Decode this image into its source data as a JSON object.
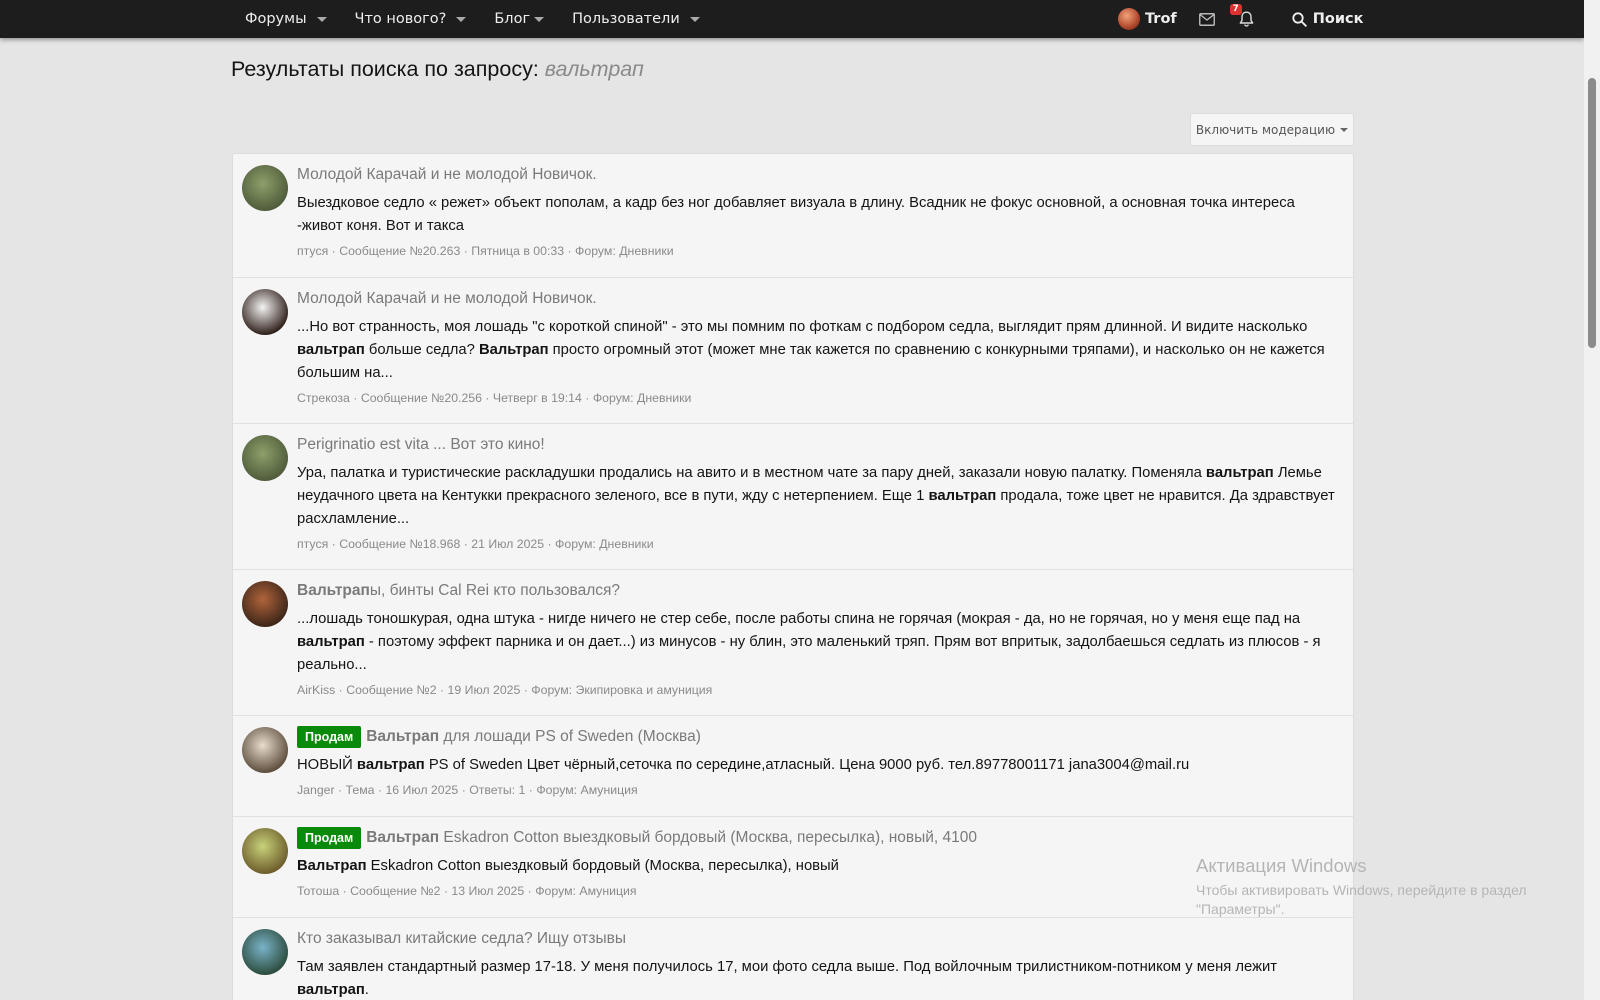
{
  "nav": {
    "items": [
      {
        "label": "Форумы"
      },
      {
        "label": "Что нового?"
      },
      {
        "label": "Блог"
      },
      {
        "label": "Пользователи"
      }
    ],
    "user": "Trof",
    "alerts_count": "7",
    "search_label": "Поиск"
  },
  "page": {
    "title_prefix": "Результаты поиска по запросу:",
    "query": "вальтрап",
    "moderation_button": "Включить модерацию"
  },
  "results": [
    {
      "title_pre": "",
      "title_bold": "",
      "title_rest": "Молодой Карачай и не молодой Новичок.",
      "label": "",
      "snippet": [
        {
          "t": "Выездковое седло « режет» объект пополам, а кадр без ног добавляет визуала в длину. Всадник не фокус основной, а основная точка интереса -живот коня. Вот и такса",
          "b": false
        }
      ],
      "meta": [
        "птуся",
        "Сообщение №20.263",
        "Пятница в 00:33",
        "Форум: Дневники"
      ],
      "avatar_colors": [
        "#8da06a",
        "#4e5a3a"
      ]
    },
    {
      "title_pre": "",
      "title_bold": "",
      "title_rest": "Молодой Карачай и не молодой Новичок.",
      "label": "",
      "snippet": [
        {
          "t": "...Но вот странность, моя лошадь \"с короткой спиной\" - это мы помним по фоткам с подбором седла, выглядит прям длинной. И видите насколько ",
          "b": false
        },
        {
          "t": "вальтрап",
          "b": true
        },
        {
          "t": " больше седла? ",
          "b": false
        },
        {
          "t": "Вальтрап",
          "b": true
        },
        {
          "t": " просто огромный этот (может мне так кажется по сравнению с конкурными тряпами), и насколько он не кажется большим на...",
          "b": false
        }
      ],
      "meta": [
        "Стрекоза",
        "Сообщение №20.256",
        "Четверг в 19:14",
        "Форум: Дневники"
      ],
      "avatar_colors": [
        "#f3f3f3",
        "#2a1a14"
      ]
    },
    {
      "title_pre": "",
      "title_bold": "",
      "title_rest": "Perigrinatio est vita ... Вот это кино!",
      "label": "",
      "snippet": [
        {
          "t": "Ура, палатка и туристические раскладушки продались на авито и в местном чате за пару дней, заказали новую палатку. Поменяла ",
          "b": false
        },
        {
          "t": "вальтрап",
          "b": true
        },
        {
          "t": " Лемье неудачного цвета на Кентукки прекрасного зеленого, все в пути, жду с нетерпением. Еще 1 ",
          "b": false
        },
        {
          "t": "вальтрап",
          "b": true
        },
        {
          "t": " продала, тоже цвет не нравится. Да здравствует расхламление...",
          "b": false
        }
      ],
      "meta": [
        "птуся",
        "Сообщение №18.968",
        "21 Июл 2025",
        "Форум: Дневники"
      ],
      "avatar_colors": [
        "#8da06a",
        "#4e5a3a"
      ]
    },
    {
      "title_pre": "",
      "title_bold": "Вальтрап",
      "title_rest": "ы, бинты Cal Rei кто пользовался?",
      "label": "",
      "snippet": [
        {
          "t": "...лошадь тоношкурая, одна штука - нигде ничего не стер себе, после работы спина не горячая (мокрая - да, но не горячая, но у меня еще пад на ",
          "b": false
        },
        {
          "t": "вальтрап",
          "b": true
        },
        {
          "t": " - поэтому эффект парника и он дает...) из минусов - ну блин, это маленький тряп. Прям вот впритык, задолбаешься седлать из плюсов - я реально...",
          "b": false
        }
      ],
      "meta": [
        "AirKiss",
        "Сообщение №2",
        "19 Июл 2025",
        "Форум: Экипировка и амуниция"
      ],
      "avatar_colors": [
        "#b0643a",
        "#3a2418"
      ]
    },
    {
      "title_pre": "",
      "title_bold": "Вальтрап",
      "title_rest": " для лошади PS of Sweden (Москва)",
      "label": "Продам",
      "snippet": [
        {
          "t": "НОВЫЙ ",
          "b": false
        },
        {
          "t": "вальтрап",
          "b": true
        },
        {
          "t": " PS of Sweden Цвет чёрный,сеточка по середине,атласный. Цена 9000 руб. тел.89778001171 jana3004@mail.ru",
          "b": false
        }
      ],
      "meta": [
        "Janger",
        "Тема",
        "16 Июл 2025",
        "Ответы: 1",
        "Форум: Амуниция"
      ],
      "avatar_colors": [
        "#e8dccc",
        "#5a4a3a"
      ]
    },
    {
      "title_pre": "",
      "title_bold": "Вальтрап",
      "title_rest": " Eskadron Cotton выездковый бордовый (Москва, пересылка), новый, 4100",
      "label": "Продам",
      "snippet": [
        {
          "t": "Вальтрап",
          "b": true
        },
        {
          "t": " Eskadron Cotton выездковый бордовый (Москва, пересылка), новый",
          "b": false
        }
      ],
      "meta": [
        "Тотоша",
        "Сообщение №2",
        "13 Июл 2025",
        "Форум: Амуниция"
      ],
      "avatar_colors": [
        "#c8d27a",
        "#6b5a2a"
      ]
    },
    {
      "title_pre": "",
      "title_bold": "",
      "title_rest": "Кто заказывал китайские седла? Ищу отзывы",
      "label": "",
      "snippet": [
        {
          "t": "Там заявлен стандартный размер 17-18. У меня получилось 17, мои фото седла выше. Под войлочным трилистником-потником у меня лежит ",
          "b": false
        },
        {
          "t": "вальтрап",
          "b": true
        },
        {
          "t": ".",
          "b": false
        }
      ],
      "meta": [],
      "avatar_colors": [
        "#7ab3c8",
        "#2a4a3a"
      ]
    }
  ],
  "watermark": {
    "line1": "Активация Windows",
    "line2": "Чтобы активировать Windows, перейдите в раздел",
    "line3": "\"Параметры\"."
  }
}
